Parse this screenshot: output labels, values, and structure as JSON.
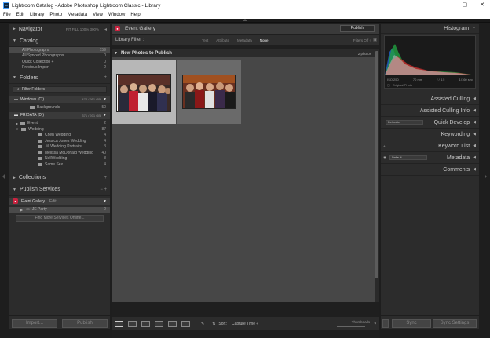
{
  "window": {
    "title": "Lightroom Catalog - Adobe Photoshop Lightroom Classic - Library",
    "app_icon": "Lr",
    "controls": [
      "—",
      "▢",
      "✕"
    ]
  },
  "menu": [
    "File",
    "Edit",
    "Library",
    "Photo",
    "Metadata",
    "View",
    "Window",
    "Help"
  ],
  "left": {
    "navigator": {
      "label": "Navigator",
      "opts": "FIT  FILL  100%  300%"
    },
    "catalog": {
      "label": "Catalog",
      "items": [
        {
          "label": "All Photographs",
          "count": "159"
        },
        {
          "label": "All Synced Photographs",
          "count": "0"
        },
        {
          "label": "Quick Collection +",
          "count": "0"
        },
        {
          "label": "Previous Import",
          "count": "2"
        }
      ]
    },
    "folders": {
      "label": "Folders",
      "filter_label": "Filter Folders",
      "vol1": {
        "label": "Windows (C:)",
        "meta": "474 / 951 GB"
      },
      "vol1_items": [
        {
          "label": "Backgrounds",
          "count": "50"
        }
      ],
      "vol2": {
        "label": "FRIDATA (D:)",
        "meta": "371 / 931 GB"
      },
      "vol2_items": [
        {
          "label": "Event",
          "count": "2"
        },
        {
          "label": "Wedding",
          "count": "87"
        }
      ],
      "wedding_sub": [
        {
          "label": "Chen Wedding",
          "count": "4"
        },
        {
          "label": "Jessica Jones Wedding",
          "count": "4"
        },
        {
          "label": "Jill Wedding Portraits",
          "count": "3"
        },
        {
          "label": "Melissa McDonald Wedding",
          "count": "40"
        },
        {
          "label": "NellWedding",
          "count": "8"
        },
        {
          "label": "Same Sex",
          "count": "4"
        }
      ]
    },
    "collections": {
      "label": "Collections"
    },
    "publish": {
      "label": "Publish Services",
      "service": {
        "label": "Event Gallery",
        "meta": "Edit"
      },
      "item": {
        "label": "JE Party",
        "count": "2"
      },
      "find_more": "Find More Services Online..."
    },
    "import_label": "Import...",
    "publish_label": "Publish"
  },
  "center": {
    "pubbar_label": "Event Gallery",
    "publish_button": "Publish",
    "filter_label": "Library Filter :",
    "filter_opts": [
      "Text",
      "Attribute",
      "Metadata",
      "None"
    ],
    "filters_off": "Filters Off ÷",
    "section_title": "New Photos to Publish",
    "section_count": "2 photos",
    "toolbar": {
      "sort_label": "Sort:",
      "sort_value": "Capture Time ÷",
      "thumbs_label": "Thumbnails"
    }
  },
  "right": {
    "histogram_label": "Histogram",
    "hist_info": [
      "ISO 250",
      "70 mm",
      "f / 4.5",
      "1/160 sec"
    ],
    "original_photo": "Original Photo",
    "sections": [
      {
        "label": "Assisted Culling"
      },
      {
        "label": "Assisted Culling Info"
      },
      {
        "label": "Quick Develop",
        "ctrl": "Defaults"
      },
      {
        "label": "Keywording"
      },
      {
        "label": "Keyword List",
        "ctrl": "+"
      },
      {
        "label": "Metadata",
        "ctrl": "Default"
      },
      {
        "label": "Comments"
      }
    ],
    "sync_label": "Sync",
    "sync_settings_label": "Sync Settings"
  },
  "colors": {
    "publish_icon": "#c8233f",
    "selected_cell": "#b7b7b7"
  }
}
